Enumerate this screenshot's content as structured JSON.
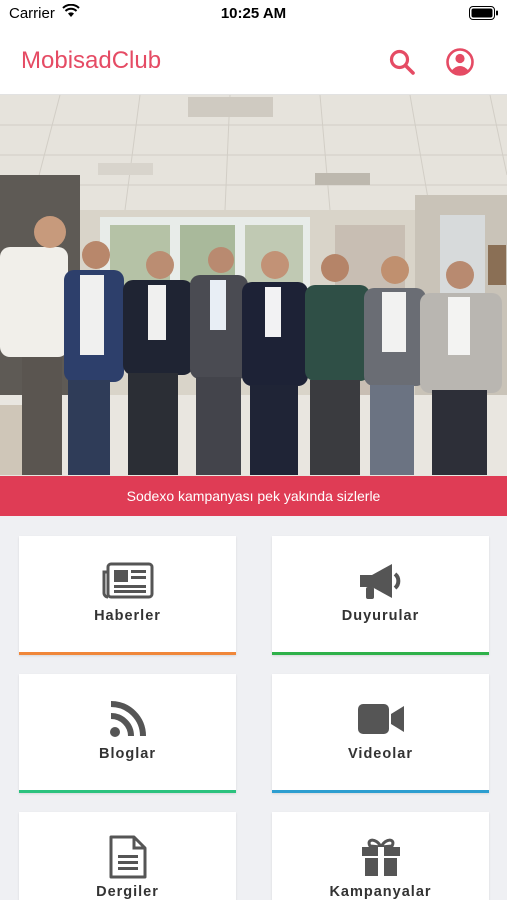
{
  "status": {
    "carrier": "Carrier",
    "time": "10:25 AM"
  },
  "header": {
    "title": "MobisadClub"
  },
  "banner": {
    "text": "Sodexo kampanyası pek yakında sizlerle"
  },
  "tiles": [
    {
      "label": "Haberler",
      "icon": "newspaper-icon",
      "color": "#f0873a"
    },
    {
      "label": "Duyurular",
      "icon": "megaphone-icon",
      "color": "#2fb14a"
    },
    {
      "label": "Bloglar",
      "icon": "rss-icon",
      "color": "#2bc27e"
    },
    {
      "label": "Videolar",
      "icon": "video-camera-icon",
      "color": "#2d9ed0"
    },
    {
      "label": "Dergiler",
      "icon": "document-icon",
      "color": "#8a5cc2"
    },
    {
      "label": "Kampanyalar",
      "icon": "gift-icon",
      "color": "#e54b64"
    }
  ],
  "colors": {
    "accent": "#e54b64",
    "banner": "#df3c55"
  }
}
